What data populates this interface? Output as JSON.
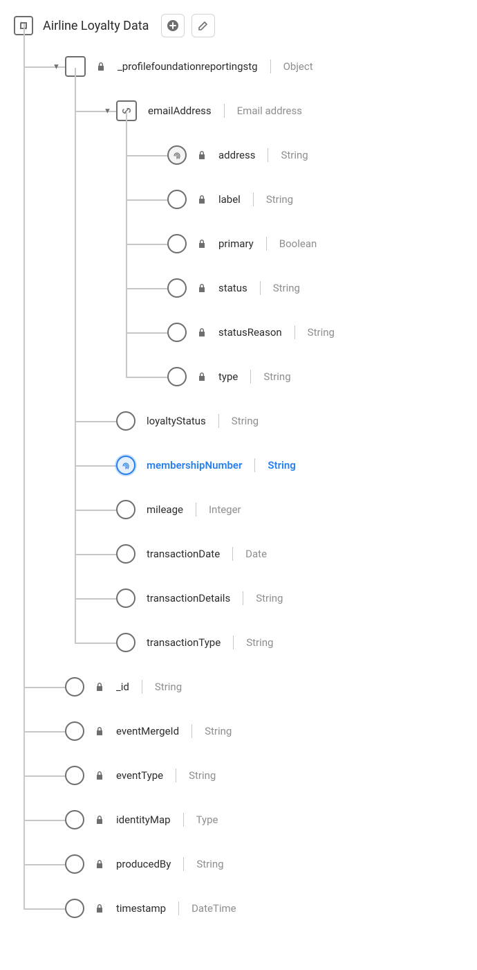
{
  "root": {
    "title": "Airline Loyalty Data"
  },
  "level1": {
    "profile": {
      "name": "_profilefoundationreportingstg",
      "type": "Object",
      "locked": true
    },
    "items": [
      {
        "name": "_id",
        "type": "String",
        "locked": true
      },
      {
        "name": "eventMergeId",
        "type": "String",
        "locked": true
      },
      {
        "name": "eventType",
        "type": "String",
        "locked": true
      },
      {
        "name": "identityMap",
        "type": "Type",
        "locked": true
      },
      {
        "name": "producedBy",
        "type": "String",
        "locked": true
      },
      {
        "name": "timestamp",
        "type": "DateTime",
        "locked": true
      }
    ]
  },
  "level2": {
    "email": {
      "name": "emailAddress",
      "type": "Email address"
    },
    "items": [
      {
        "name": "loyaltyStatus",
        "type": "String"
      },
      {
        "name": "membershipNumber",
        "type": "String",
        "selected": true,
        "identity": true
      },
      {
        "name": "mileage",
        "type": "Integer"
      },
      {
        "name": "transactionDate",
        "type": "Date"
      },
      {
        "name": "transactionDetails",
        "type": "String"
      },
      {
        "name": "transactionType",
        "type": "String"
      }
    ]
  },
  "level3": {
    "items": [
      {
        "name": "address",
        "type": "String",
        "locked": true,
        "identity": true
      },
      {
        "name": "label",
        "type": "String",
        "locked": true
      },
      {
        "name": "primary",
        "type": "Boolean",
        "locked": true
      },
      {
        "name": "status",
        "type": "String",
        "locked": true
      },
      {
        "name": "statusReason",
        "type": "String",
        "locked": true
      },
      {
        "name": "type",
        "type": "String",
        "locked": true
      }
    ]
  }
}
